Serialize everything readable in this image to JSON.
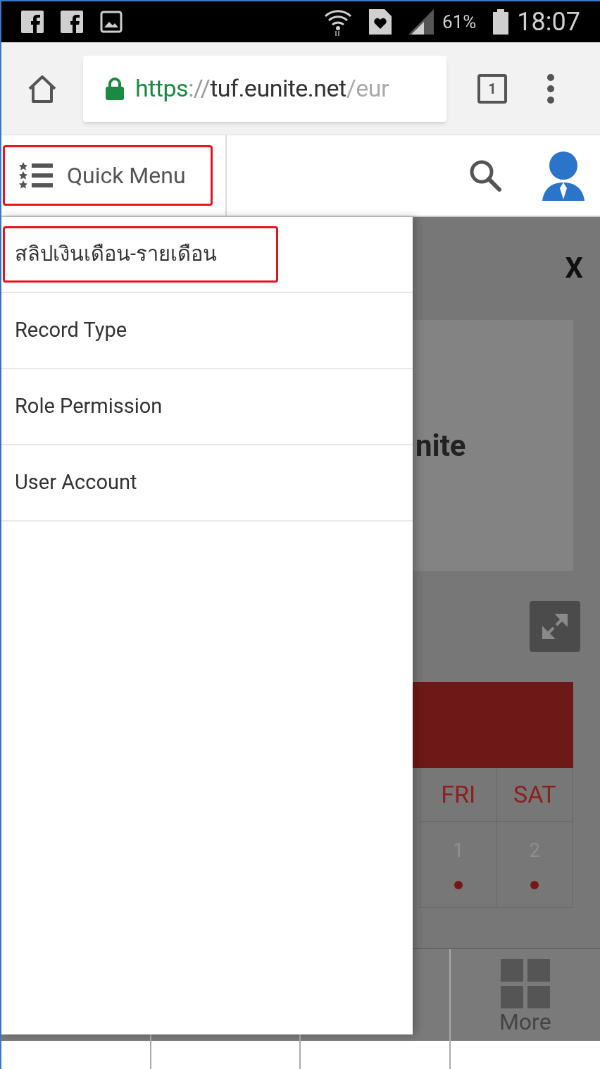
{
  "status_bar": {
    "battery": "61%",
    "time": "18:07"
  },
  "browser": {
    "url": [
      {
        "kind": "scheme",
        "text": "https"
      },
      {
        "kind": "sep",
        "text": "://"
      },
      {
        "kind": "host",
        "text": "tuf.eunite.net"
      },
      {
        "kind": "path",
        "text": "/eur"
      }
    ],
    "tab_count": "1"
  },
  "header": {
    "quick_menu": {
      "label": "Quick Menu",
      "highlighted": true
    }
  },
  "drawer": {
    "items": [
      {
        "label": "สลิปเงินเดือน-รายเดือน",
        "highlighted": true
      },
      {
        "label": "Record Type",
        "highlighted": false
      },
      {
        "label": "Role Permission",
        "highlighted": false
      },
      {
        "label": "User Account",
        "highlighted": false
      }
    ]
  },
  "background": {
    "close": "X",
    "card_text": "nite",
    "calendar": {
      "headers": [
        "FRI",
        "SAT"
      ],
      "days": [
        {
          "label": "1",
          "has_event": true
        },
        {
          "label": "2",
          "has_event": true
        }
      ]
    }
  },
  "bottom_nav": {
    "items": [
      {
        "label": "More"
      }
    ]
  }
}
